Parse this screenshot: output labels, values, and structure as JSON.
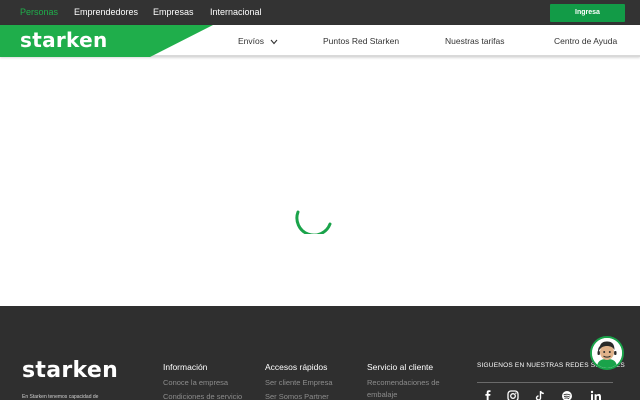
{
  "topbar": {
    "segments": [
      "Personas",
      "Emprendedores",
      "Empresas",
      "Internacional"
    ],
    "login_label": "Ingresa"
  },
  "header": {
    "logo": "starken",
    "nav": [
      "Envíos",
      "Puntos Red Starken",
      "Nuestras tarifas",
      "Centro de Ayuda"
    ]
  },
  "footer": {
    "logo": "starken",
    "tagline": "En Starken tenemos capacidad de",
    "columns": [
      {
        "title": "Información",
        "links": [
          "Conoce la empresa",
          "Condiciones de servicio"
        ]
      },
      {
        "title": "Accesos rápidos",
        "links": [
          "Ser cliente Empresa",
          "Ser Somos Partner"
        ]
      },
      {
        "title": "Servicio al cliente",
        "links": [
          "Recomendaciones de",
          "embalaje"
        ]
      }
    ],
    "social_title": "SIGUENOS EN NUESTRAS REDES SOCIALES",
    "social_icons": [
      "facebook-icon",
      "instagram-icon",
      "tiktok-icon",
      "spotify-icon",
      "linkedin-icon"
    ]
  },
  "colors": {
    "brand_green": "#1fae4b",
    "button_green": "#129b47",
    "dark": "#333333"
  }
}
